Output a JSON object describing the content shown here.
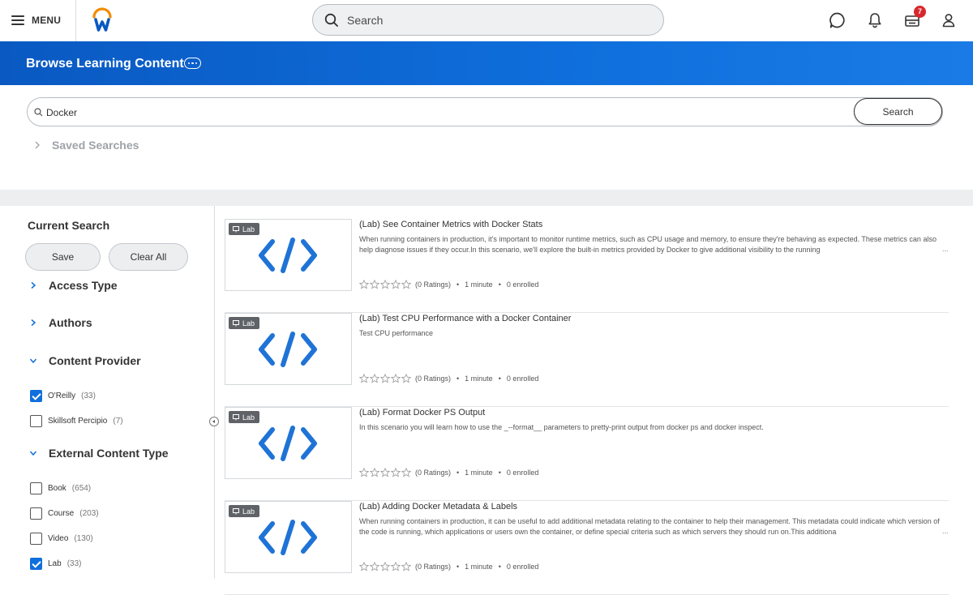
{
  "topbar": {
    "menu_label": "MENU",
    "search_placeholder": "Search",
    "inbox_badge": "7",
    "icons": [
      "chat-icon",
      "bell-icon",
      "inbox-icon",
      "user-icon"
    ],
    "logo_letter": "W"
  },
  "header": {
    "title": "Browse Learning Content"
  },
  "search": {
    "value": "Docker",
    "button": "Search",
    "saved_searches": "Saved Searches"
  },
  "facets": {
    "current_search": "Current Search",
    "save": "Save",
    "clear_all": "Clear All",
    "groups": [
      {
        "title": "Access Type",
        "expanded": false
      },
      {
        "title": "Authors",
        "expanded": false
      },
      {
        "title": "Content Provider",
        "expanded": true,
        "options": [
          {
            "label": "O'Reilly",
            "count": "(33)",
            "checked": true
          },
          {
            "label": "Skillsoft Percipio",
            "count": "(7)",
            "checked": false
          }
        ]
      },
      {
        "title": "External Content Type",
        "expanded": true,
        "options": [
          {
            "label": "Book",
            "count": "(654)",
            "checked": false
          },
          {
            "label": "Course",
            "count": "(203)",
            "checked": false
          },
          {
            "label": "Video",
            "count": "(130)",
            "checked": false
          },
          {
            "label": "Lab",
            "count": "(33)",
            "checked": true
          }
        ]
      }
    ]
  },
  "results": [
    {
      "tag": "Lab",
      "title": "(Lab) See Container Metrics with Docker Stats",
      "description": "When running containers in production, it's important to monitor runtime metrics, such as CPU usage and memory, to ensure they're behaving as expected. These metrics can also help diagnose issues if they occur.In this scenario, we'll explore the built-in metrics provided by Docker to give additional visibility to the running",
      "ellipsis": "...",
      "ratings": "(0 Ratings)",
      "duration": "1 minute",
      "enrolled": "0 enrolled"
    },
    {
      "tag": "Lab",
      "title": "(Lab) Test CPU Performance with a Docker Container",
      "description": "Test CPU performance",
      "ellipsis": "",
      "ratings": "(0 Ratings)",
      "duration": "1 minute",
      "enrolled": "0 enrolled"
    },
    {
      "tag": "Lab",
      "title": "(Lab) Format Docker PS Output",
      "description": "In this scenario you will learn how to use the _--format__ parameters to pretty-print output from docker ps and docker inspect.",
      "ellipsis": "",
      "ratings": "(0 Ratings)",
      "duration": "1 minute",
      "enrolled": "0 enrolled"
    },
    {
      "tag": "Lab",
      "title": "(Lab) Adding Docker Metadata & Labels",
      "description": "When running containers in production, it can be useful to add additional metadata relating to the container to help their management. This metadata could indicate which version of the code is running, which applications or users own the container, or define special criteria such as which servers they should run on.This additiona",
      "ellipsis": "...",
      "ratings": "(0 Ratings)",
      "duration": "1 minute",
      "enrolled": "0 enrolled"
    }
  ],
  "meta_separator": "•",
  "colors": {
    "brand_blue": "#0f6fdc",
    "code_icon_blue": "#1f73d6",
    "badge_red": "#d9272e",
    "logo_orange": "#f38b00"
  }
}
